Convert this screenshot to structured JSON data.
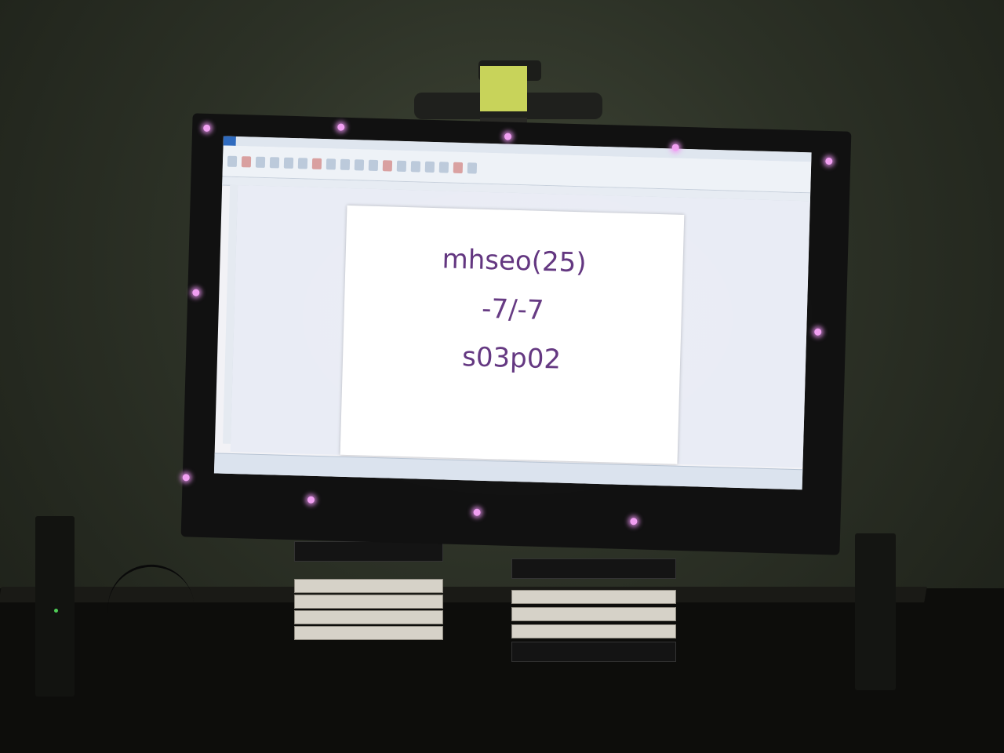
{
  "document": {
    "lines": [
      "mhseo(25)",
      "-7/-7",
      "s03p02"
    ]
  },
  "scene": {
    "accent_text_color": "#5b2c7a",
    "marker_color": "#f19ff2",
    "wall_color": "#2c3126"
  },
  "icons": [
    "webcam-icon",
    "speaker-icon",
    "marker-icon"
  ]
}
